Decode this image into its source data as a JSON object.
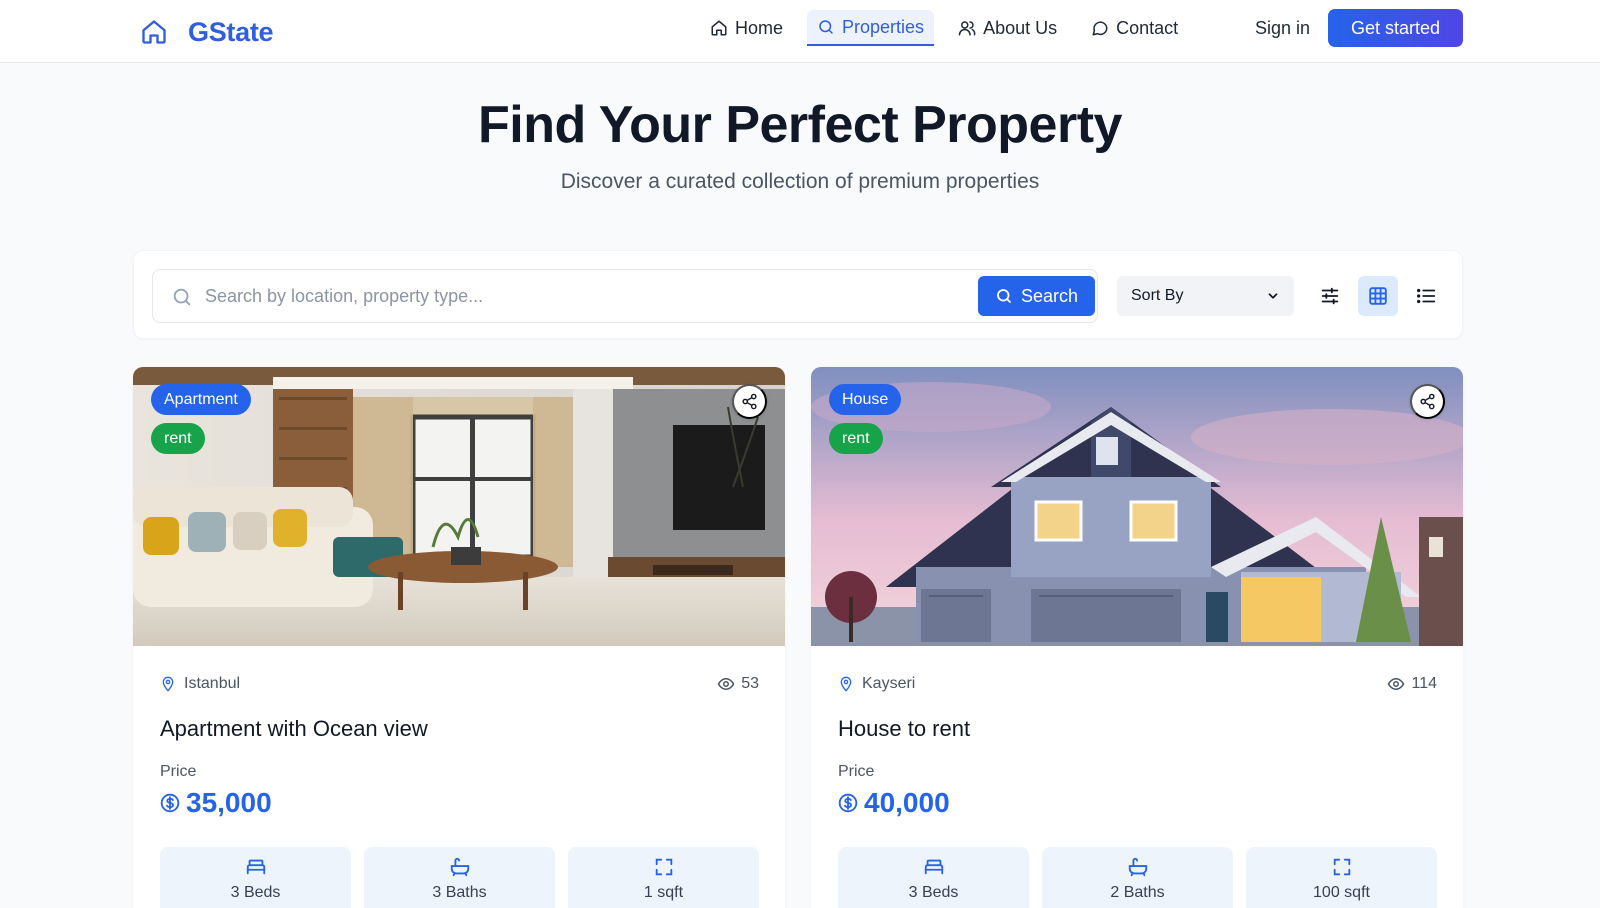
{
  "nav": {
    "brand": "GState",
    "links": [
      {
        "label": "Home",
        "icon": "home-icon"
      },
      {
        "label": "Properties",
        "icon": "search-icon",
        "active": true
      },
      {
        "label": "About Us",
        "icon": "users-icon"
      },
      {
        "label": "Contact",
        "icon": "message-icon"
      }
    ],
    "signin": "Sign in",
    "cta": "Get started"
  },
  "hero": {
    "title": "Find Your Perfect Property",
    "subtitle": "Discover a curated collection of premium properties"
  },
  "search": {
    "placeholder": "Search by location, property type...",
    "button": "Search",
    "sort_label": "Sort By",
    "active_view": "grid"
  },
  "listings": [
    {
      "type": "Apartment",
      "deal": "rent",
      "location": "Istanbul",
      "views": "53",
      "title": "Apartment with Ocean view",
      "price_label": "Price",
      "price": "35,000",
      "beds": "3 Beds",
      "baths": "3 Baths",
      "area": "1 sqft"
    },
    {
      "type": "House",
      "deal": "rent",
      "location": "Kayseri",
      "views": "114",
      "title": "House to rent",
      "price_label": "Price",
      "price": "40,000",
      "beds": "3 Beds",
      "baths": "2 Baths",
      "area": "100 sqft"
    }
  ],
  "colors": {
    "primary": "#2563eb",
    "brand": "#2f5ee0",
    "rent_badge": "#16a34a",
    "background": "#f8fafc"
  }
}
